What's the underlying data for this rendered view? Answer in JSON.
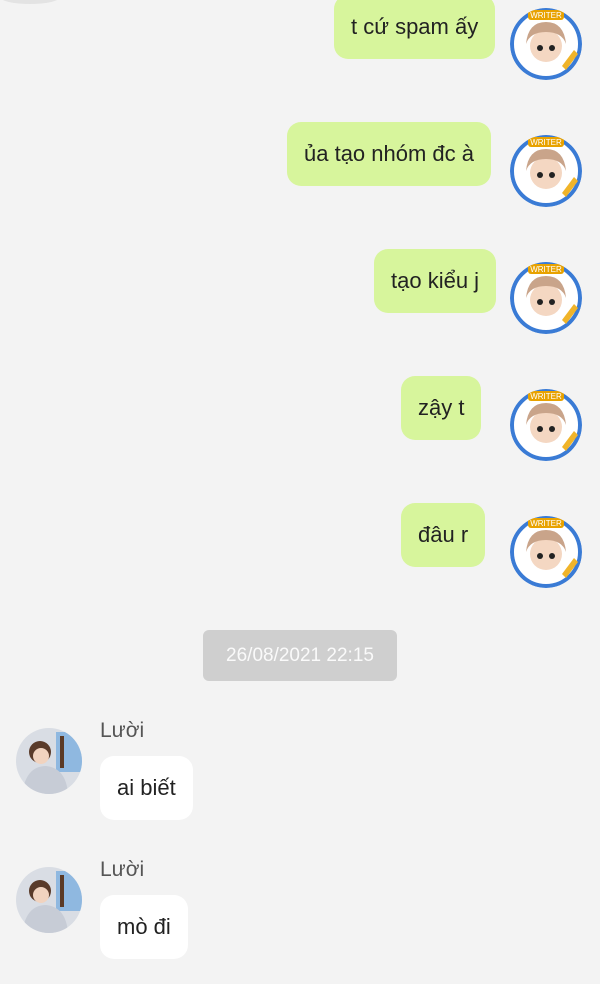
{
  "outgoing": [
    {
      "text": "t cứ spam ấy"
    },
    {
      "text": "ủa tạo nhóm đc à"
    },
    {
      "text": "tạo kiểu j"
    },
    {
      "text": "zậy t"
    },
    {
      "text": "đâu r"
    }
  ],
  "timestamp": "26/08/2021 22:15",
  "incoming": [
    {
      "sender": "Lười",
      "text": "ai biết"
    },
    {
      "sender": "Lười",
      "text": "mò đi"
    }
  ],
  "avatar_badge_text": "WRITER",
  "colors": {
    "background": "#f3f3f3",
    "outgoing_bubble": "#d7f59c",
    "incoming_bubble": "#ffffff",
    "timestamp_pill": "#cfcfcf"
  }
}
